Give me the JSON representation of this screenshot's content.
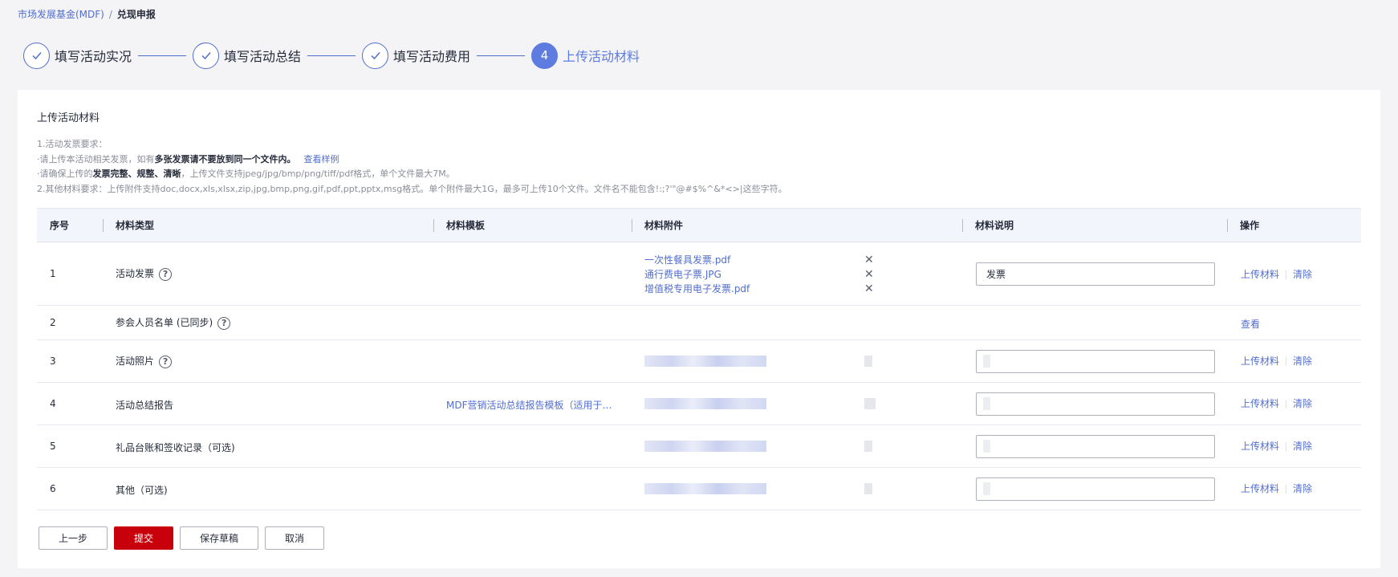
{
  "breadcrumb": {
    "parent": "市场发展基金(MDF)",
    "separator": "/",
    "current": "兑现申报"
  },
  "steps": [
    {
      "label": "填写活动实况",
      "status": "done"
    },
    {
      "label": "填写活动总结",
      "status": "done"
    },
    {
      "label": "填写活动费用",
      "status": "done"
    },
    {
      "number": "4",
      "label": "上传活动材料",
      "status": "active"
    }
  ],
  "panel": {
    "title": "上传活动材料",
    "notes": {
      "line1": "1.活动发票要求：",
      "line2_a": "·请上传本活动相关发票，如有",
      "line2_b": "多张发票请不要放到同一个文件内。",
      "line2_link": "查看样例",
      "line3_a": "·请确保上传的",
      "line3_b": "发票完整、规整、清晰",
      "line3_c": "，上传文件支持jpeg/jpg/bmp/png/tiff/pdf格式，单个文件最大7M。",
      "line4": "2.其他材料要求：上传附件支持doc,docx,xls,xlsx,zip,jpg,bmp,png,gif,pdf,ppt,pptx,msg格式。单个附件最大1G，最多可上传10个文件。文件名不能包含!:;?'\"@#$%^&*<>|这些字符。"
    }
  },
  "table": {
    "headers": {
      "index": "序号",
      "type": "材料类型",
      "template": "材料模板",
      "attachment": "材料附件",
      "description": "材料说明",
      "operation": "操作"
    },
    "rows": [
      {
        "index": "1",
        "type": "活动发票",
        "files": [
          "一次性餐具发票.pdf",
          "通行费电子票.JPG",
          "增值税专用电子发票.pdf"
        ],
        "description": "发票"
      },
      {
        "index": "2",
        "type": "参会人员名单 (已同步)"
      },
      {
        "index": "3",
        "type": "活动照片"
      },
      {
        "index": "4",
        "type": "活动总结报告",
        "template": "MDF营销活动总结报告模板（适用于…"
      },
      {
        "index": "5",
        "type": "礼品台账和签收记录（可选)"
      },
      {
        "index": "6",
        "type": "其他（可选)"
      }
    ],
    "help_symbol": "?",
    "delete_symbol": "✕",
    "ops": {
      "upload": "上传材料",
      "clear": "清除",
      "view": "查看"
    }
  },
  "buttons": {
    "prev": "上一步",
    "submit": "提交",
    "save_draft": "保存草稿",
    "cancel": "取消"
  },
  "colors": {
    "accent": "#526ecc",
    "active_step": "#5e7ce0",
    "primary_button": "#c7000b",
    "header_bg": "#f2f5fc"
  }
}
